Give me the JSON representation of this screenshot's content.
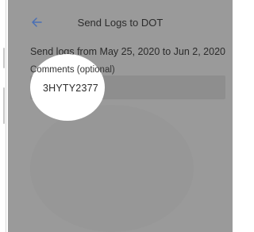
{
  "header": {
    "back_icon": "back-arrow-icon",
    "title": "Send Logs to DOT"
  },
  "form": {
    "date_range_text": "Send logs from May 25, 2020 to Jun 2, 2020",
    "comments_label": "Comments (optional)",
    "comments_value": "3HYTY2377"
  },
  "colors": {
    "accent": "#4a6fb5",
    "overlay": "#9a9a9a",
    "highlight": "#ffffff"
  }
}
